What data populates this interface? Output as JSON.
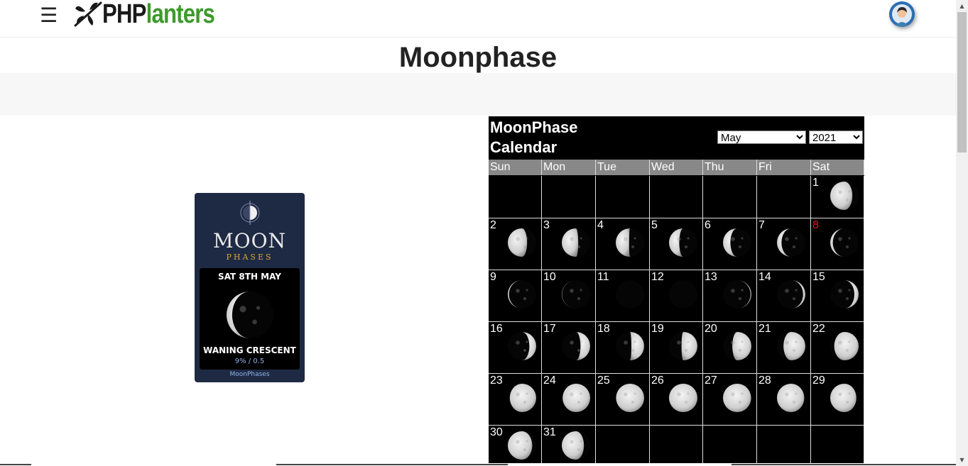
{
  "header": {
    "menu_icon": "hamburger-icon",
    "logo_php": "PHP",
    "logo_planters": "lanters",
    "logo_icon": "dragonfly-icon",
    "avatar_icon": "user-avatar-icon"
  },
  "page": {
    "title": "Moonphase"
  },
  "widget": {
    "title": "MOON",
    "subtitle": "PHASES",
    "date": "SAT 8TH MAY",
    "phase_name": "WANING CRESCENT",
    "illumination": "9% / 0.5",
    "link": "MoonPhases",
    "illum_fraction": 0.09
  },
  "calendar": {
    "title_line1": "MoonPhase",
    "title_line2": "Calendar",
    "selected_month": "May",
    "selected_year": "2021",
    "weekdays": [
      "Sun",
      "Mon",
      "Tue",
      "Wed",
      "Thu",
      "Fri",
      "Sat"
    ],
    "today": 8,
    "days": [
      {
        "d": 1,
        "illum": 0.78,
        "waxing": false
      },
      {
        "d": 2,
        "illum": 0.68,
        "waxing": false
      },
      {
        "d": 3,
        "illum": 0.58,
        "waxing": false
      },
      {
        "d": 4,
        "illum": 0.47,
        "waxing": false
      },
      {
        "d": 5,
        "illum": 0.36,
        "waxing": false
      },
      {
        "d": 6,
        "illum": 0.26,
        "waxing": false
      },
      {
        "d": 7,
        "illum": 0.16,
        "waxing": false
      },
      {
        "d": 8,
        "illum": 0.09,
        "waxing": false
      },
      {
        "d": 9,
        "illum": 0.04,
        "waxing": false
      },
      {
        "d": 10,
        "illum": 0.01,
        "waxing": false
      },
      {
        "d": 11,
        "illum": 0.0,
        "waxing": true
      },
      {
        "d": 12,
        "illum": 0.0,
        "waxing": true
      },
      {
        "d": 13,
        "illum": 0.03,
        "waxing": true
      },
      {
        "d": 14,
        "illum": 0.08,
        "waxing": true
      },
      {
        "d": 15,
        "illum": 0.15,
        "waxing": true
      },
      {
        "d": 16,
        "illum": 0.24,
        "waxing": true
      },
      {
        "d": 17,
        "illum": 0.34,
        "waxing": true
      },
      {
        "d": 18,
        "illum": 0.45,
        "waxing": true
      },
      {
        "d": 19,
        "illum": 0.56,
        "waxing": true
      },
      {
        "d": 20,
        "illum": 0.67,
        "waxing": true
      },
      {
        "d": 21,
        "illum": 0.77,
        "waxing": true
      },
      {
        "d": 22,
        "illum": 0.86,
        "waxing": true
      },
      {
        "d": 23,
        "illum": 0.93,
        "waxing": true
      },
      {
        "d": 24,
        "illum": 0.97,
        "waxing": true
      },
      {
        "d": 25,
        "illum": 0.99,
        "waxing": true
      },
      {
        "d": 26,
        "illum": 1.0,
        "waxing": true
      },
      {
        "d": 27,
        "illum": 0.99,
        "waxing": false
      },
      {
        "d": 28,
        "illum": 0.96,
        "waxing": false
      },
      {
        "d": 29,
        "illum": 0.92,
        "waxing": false
      },
      {
        "d": 30,
        "illum": 0.86,
        "waxing": false
      },
      {
        "d": 31,
        "illum": 0.78,
        "waxing": false
      }
    ],
    "first_weekday": 6
  },
  "colors": {
    "brand_green": "#3d9a2b",
    "today_red": "#e0161b",
    "widget_bg": "#1e2a44"
  }
}
